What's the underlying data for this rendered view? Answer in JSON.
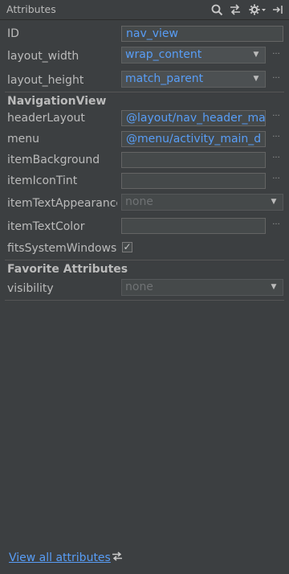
{
  "header": {
    "title": "Attributes"
  },
  "attributes": {
    "id": {
      "label": "ID",
      "value": "nav_view"
    },
    "layout_width": {
      "label": "layout_width",
      "value": "wrap_content"
    },
    "layout_height": {
      "label": "layout_height",
      "value": "match_parent"
    }
  },
  "navigation_view": {
    "title": "NavigationView",
    "header_layout": {
      "label": "headerLayout",
      "value": "@layout/nav_header_ma"
    },
    "menu": {
      "label": "menu",
      "value": "@menu/activity_main_d"
    },
    "item_background": {
      "label": "itemBackground",
      "value": ""
    },
    "item_icon_tint": {
      "label": "itemIconTint",
      "value": ""
    },
    "item_text_appearance": {
      "label": "itemTextAppearance",
      "value": "none"
    },
    "item_text_color": {
      "label": "itemTextColor",
      "value": ""
    },
    "fits_system_windows": {
      "label": "fitsSystemWindows",
      "checked": true
    }
  },
  "favorites": {
    "title": "Favorite Attributes",
    "visibility": {
      "label": "visibility",
      "value": "none"
    }
  },
  "footer": {
    "link_label": "View all attributes"
  },
  "colors": {
    "background": "#3c3f41",
    "text": "#bbbbbb",
    "value_text": "#589df6",
    "field_border": "#646464"
  }
}
